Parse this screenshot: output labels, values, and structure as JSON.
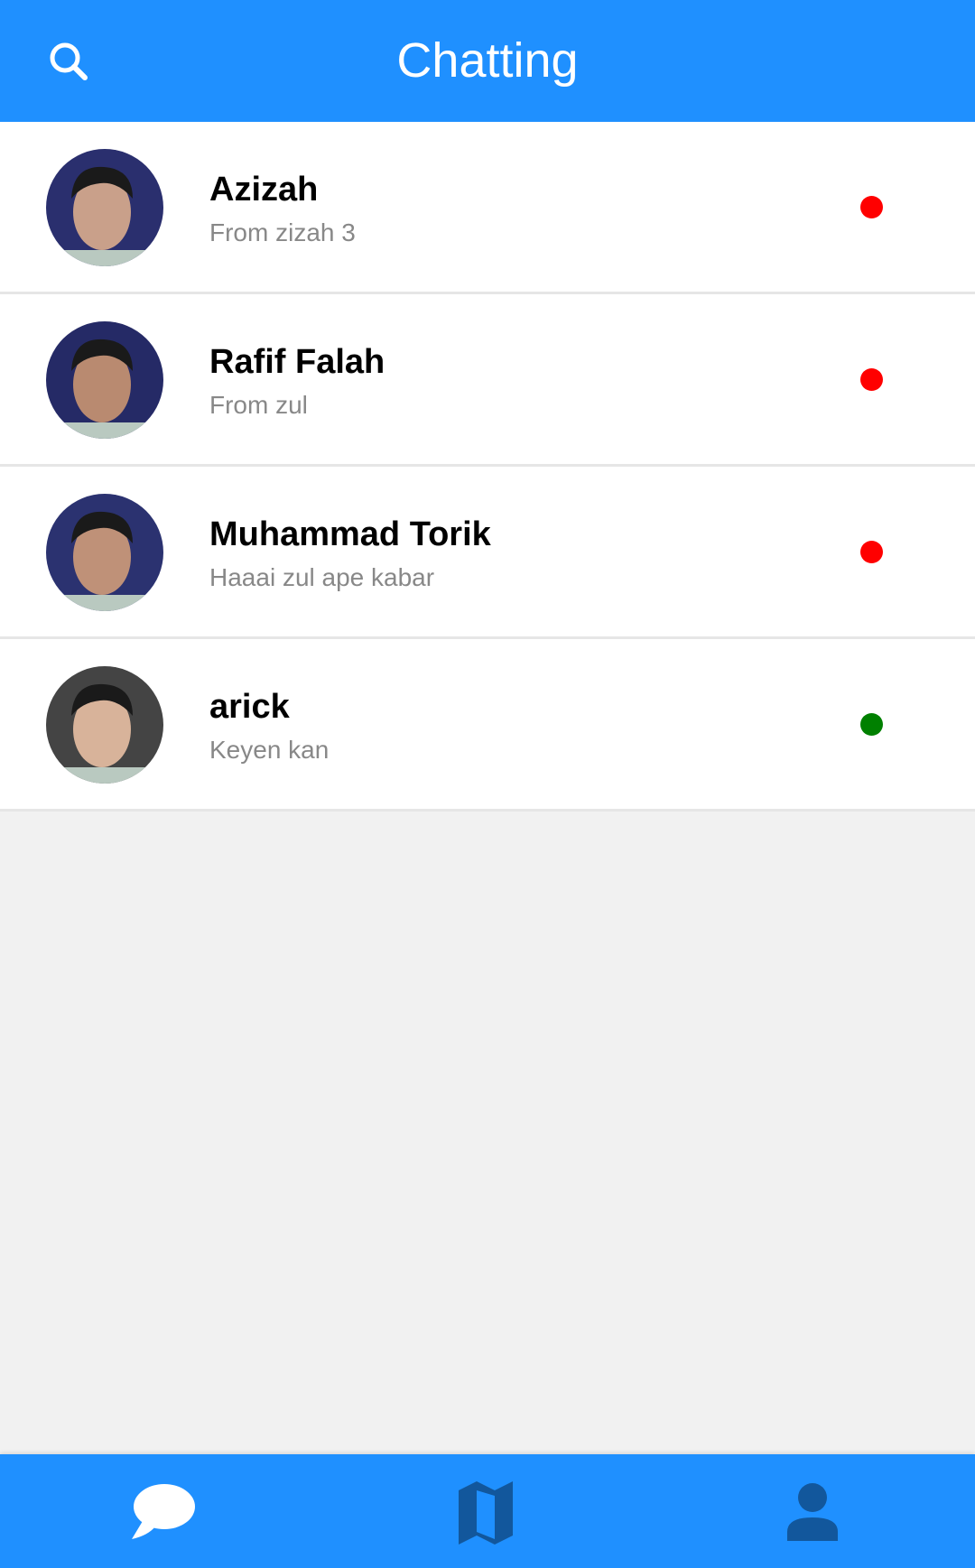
{
  "header": {
    "title": "Chatting",
    "search_icon": "search-icon"
  },
  "chats": [
    {
      "name": "Azizah",
      "message": "From zizah 3",
      "status_color": "#ff0000",
      "avatar_bg": "#2a2f6e",
      "skin": "#c9a08a"
    },
    {
      "name": "Rafif Falah",
      "message": "From zul",
      "status_color": "#ff0000",
      "avatar_bg": "#252a66",
      "skin": "#b98a70"
    },
    {
      "name": "Muhammad Torik",
      "message": "Haaai zul ape kabar",
      "status_color": "#ff0000",
      "avatar_bg": "#2b3270",
      "skin": "#bf9178"
    },
    {
      "name": "arick",
      "message": "Keyen kan",
      "status_color": "#008000",
      "avatar_bg": "#444",
      "skin": "#d8b39a"
    }
  ],
  "nav": {
    "items": [
      "chat-icon",
      "map-icon",
      "person-icon"
    ],
    "active": 0
  },
  "colors": {
    "primary": "#1f90ff",
    "inactive_icon": "#12579c"
  }
}
